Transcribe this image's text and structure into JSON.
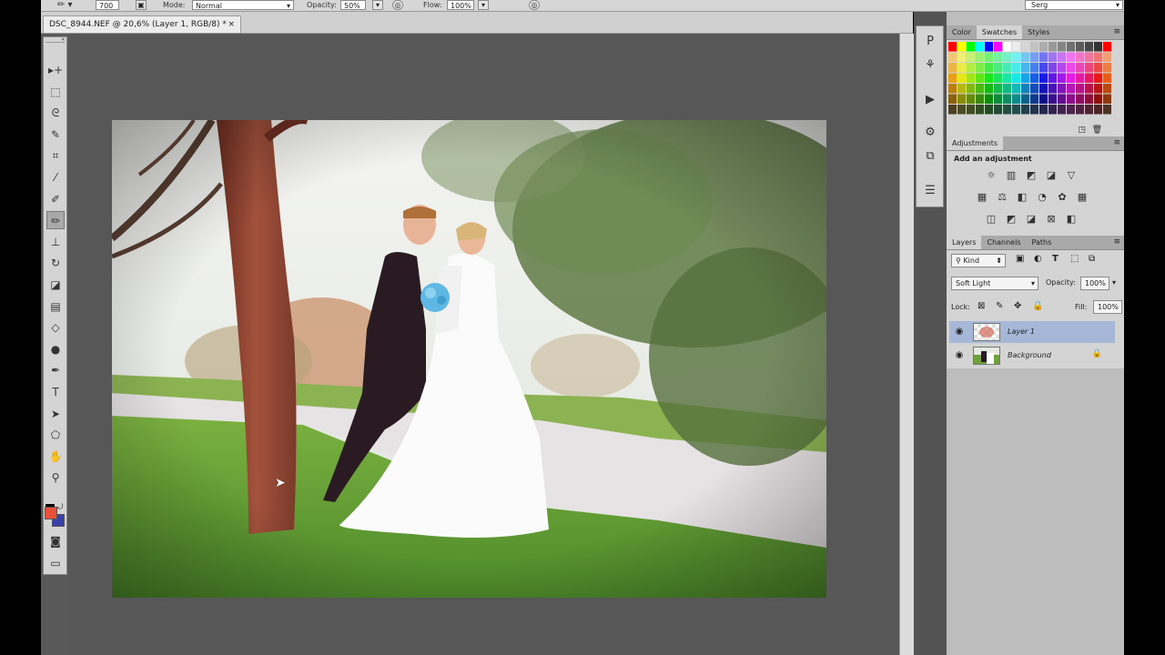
{
  "options_bar": {
    "brush_size": "700",
    "mode_label": "Mode:",
    "mode_value": "Normal",
    "opacity_label": "Opacity:",
    "opacity_value": "50%",
    "flow_label": "Flow:",
    "flow_value": "100%",
    "workspace": "Serg"
  },
  "document": {
    "tab_title": "DSC_8944.NEF @ 20,6% (Layer 1, RGB/8) *",
    "close_glyph": "×"
  },
  "toolbar": {
    "tools": [
      {
        "name": "move-tool-icon",
        "glyph": "▸+"
      },
      {
        "name": "marquee-tool-icon",
        "glyph": "⬚"
      },
      {
        "name": "lasso-tool-icon",
        "glyph": "ᘓ"
      },
      {
        "name": "quick-select-tool-icon",
        "glyph": "✎"
      },
      {
        "name": "crop-tool-icon",
        "glyph": "⌗"
      },
      {
        "name": "eyedropper-tool-icon",
        "glyph": "⁄"
      },
      {
        "name": "healing-brush-tool-icon",
        "glyph": "✐"
      },
      {
        "name": "brush-tool-icon",
        "glyph": "✏"
      },
      {
        "name": "clone-stamp-tool-icon",
        "glyph": "⊥"
      },
      {
        "name": "history-brush-tool-icon",
        "glyph": "↻"
      },
      {
        "name": "eraser-tool-icon",
        "glyph": "◪"
      },
      {
        "name": "gradient-tool-icon",
        "glyph": "▤"
      },
      {
        "name": "blur-tool-icon",
        "glyph": "◇"
      },
      {
        "name": "dodge-tool-icon",
        "glyph": "●"
      },
      {
        "name": "pen-tool-icon",
        "glyph": "✒"
      },
      {
        "name": "type-tool-icon",
        "glyph": "T"
      },
      {
        "name": "path-select-tool-icon",
        "glyph": "➤"
      },
      {
        "name": "shape-tool-icon",
        "glyph": "⬠"
      },
      {
        "name": "hand-tool-icon",
        "glyph": "✋"
      },
      {
        "name": "zoom-tool-icon",
        "glyph": "⚲"
      }
    ],
    "foreground_color": "#e8503a",
    "background_color": "#3b3fa8",
    "quick_mask_glyph": "◙",
    "screen_mode_glyph": "▭"
  },
  "dock": {
    "icons": [
      {
        "name": "paragraph-panel-icon",
        "glyph": "P"
      },
      {
        "name": "brush-presets-icon",
        "glyph": "⚘"
      },
      {
        "name": "actions-panel-icon",
        "glyph": "▶"
      },
      {
        "name": "clone-source-icon",
        "glyph": "⚙"
      },
      {
        "name": "tool-presets-icon",
        "glyph": "⧉"
      },
      {
        "name": "adjustments-dock-icon",
        "glyph": "☰"
      }
    ]
  },
  "swatches_panel": {
    "tabs": [
      "Color",
      "Swatches",
      "Styles"
    ],
    "active_tab": "Swatches"
  },
  "adjustments_panel": {
    "tab": "Adjustments",
    "heading": "Add an adjustment",
    "row1": [
      "☼",
      "▥",
      "◩",
      "◪",
      "▽"
    ],
    "row2": [
      "▦",
      "⚖",
      "◧",
      "◔",
      "✿",
      "▦"
    ],
    "row3": [
      "◫",
      "◩",
      "◪",
      "⊠",
      "◧"
    ]
  },
  "layers_panel": {
    "tabs": [
      "Layers",
      "Channels",
      "Paths"
    ],
    "active_tab": "Layers",
    "filter_kind": "Kind",
    "blend_mode": "Soft Light",
    "opacity_label": "Opacity:",
    "opacity_value": "100%",
    "lock_label": "Lock:",
    "fill_label": "Fill:",
    "fill_value": "100%",
    "layers": [
      {
        "name": "Layer 1",
        "selected": true,
        "locked": false
      },
      {
        "name": "Background",
        "selected": false,
        "locked": true
      }
    ]
  },
  "colors": {
    "ui_gray": "#d4d4d4",
    "canvas_gray": "#575757",
    "selection_blue": "#a6b7d8"
  }
}
